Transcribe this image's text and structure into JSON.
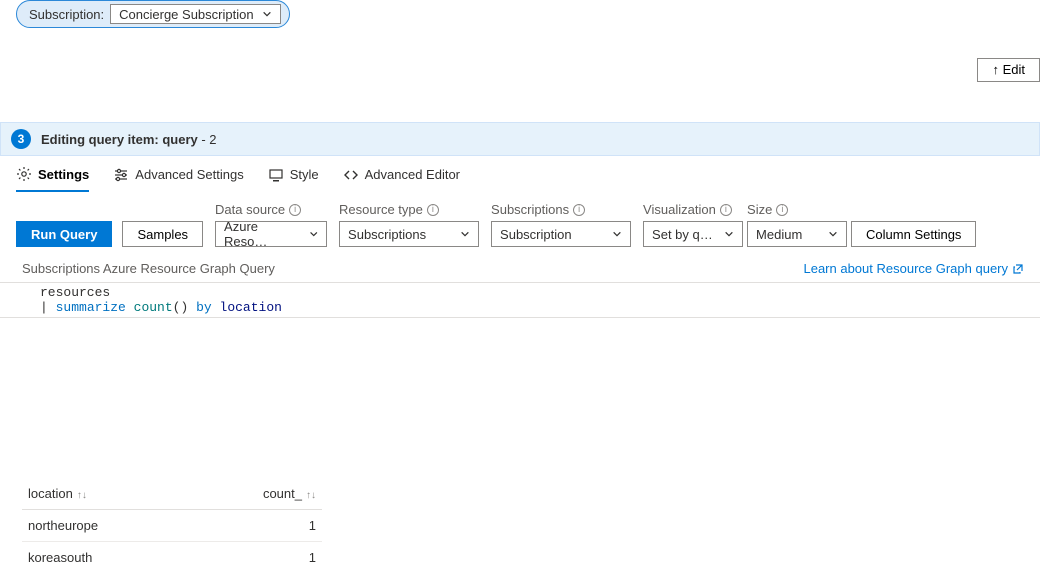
{
  "subscription": {
    "label": "Subscription:",
    "selected": "Concierge Subscription"
  },
  "editButton": "↑ Edit",
  "step": {
    "number": "3",
    "titlePrefix": "Editing query item: ",
    "itemName": "query",
    "suffix": " - 2"
  },
  "tabs": {
    "settings": "Settings",
    "advancedSettings": "Advanced Settings",
    "style": "Style",
    "advancedEditor": "Advanced Editor"
  },
  "buttons": {
    "runQuery": "Run Query",
    "samples": "Samples",
    "columnSettings": "Column Settings"
  },
  "labels": {
    "dataSource": "Data source",
    "resourceType": "Resource type",
    "subscriptions": "Subscriptions",
    "visualization": "Visualization",
    "size": "Size"
  },
  "dropdowns": {
    "dataSource": "Azure Reso…",
    "resourceType": "Subscriptions",
    "subscriptions": "Subscription",
    "visualization": "Set by q…",
    "size": "Medium"
  },
  "queryDescription": "Subscriptions Azure Resource Graph Query",
  "learnLink": "Learn about Resource Graph query",
  "code": {
    "line1": "resources",
    "pipe": "|",
    "summarize": "summarize",
    "count": "count",
    "parens": "()",
    "by": "by",
    "location": "location"
  },
  "table": {
    "headers": {
      "location": "location",
      "count": "count_"
    },
    "rows": [
      {
        "location": "northeurope",
        "count": "1"
      },
      {
        "location": "koreasouth",
        "count": "1"
      }
    ]
  }
}
